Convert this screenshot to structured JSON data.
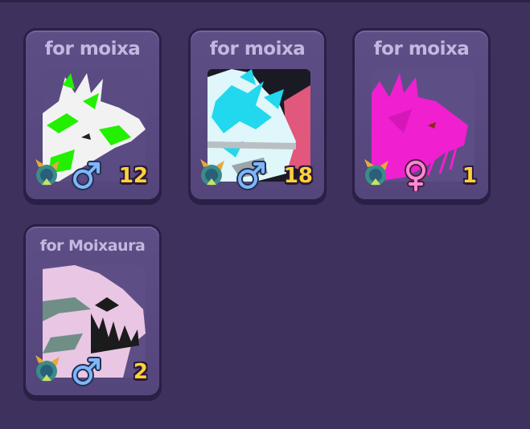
{
  "cards": [
    {
      "title": "for moixa",
      "level": "12",
      "gender": "male",
      "icon": "dragon-badge-icon",
      "art_colors": [
        "#f2f2f2",
        "#22f000"
      ]
    },
    {
      "title": "for moixa",
      "level": "18",
      "gender": "male",
      "icon": "dragon-badge-icon",
      "art_colors": [
        "#dff6fa",
        "#22d8ee",
        "#e2577c"
      ]
    },
    {
      "title": "for moixa",
      "level": "1",
      "gender": "female",
      "icon": "dragon-badge-icon",
      "art_colors": [
        "#f01fd0"
      ]
    },
    {
      "title": "for Moixaura",
      "level": "2",
      "gender": "male",
      "icon": "dragon-badge-icon",
      "art_colors": [
        "#e9c6e4",
        "#6f8e86",
        "#1b1b1b"
      ]
    }
  ],
  "colors": {
    "male": "#7fb6ff",
    "female": "#ff87d7",
    "level": "#ffd23a"
  }
}
